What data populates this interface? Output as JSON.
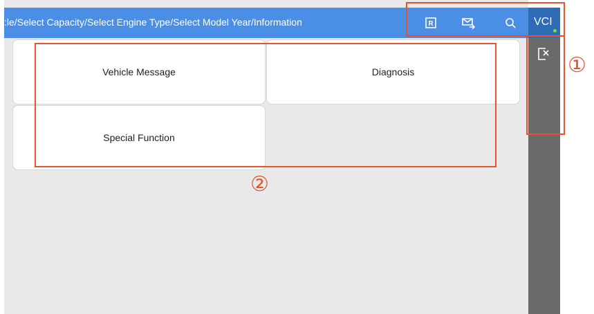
{
  "header": {
    "breadcrumb": ":le/Select Capacity/Select Engine Type/Select Model Year/Information",
    "icons": [
      "r-icon",
      "mail-icon",
      "search-icon"
    ],
    "vci_label": "VCI"
  },
  "tiles": [
    {
      "label": "Vehicle Message"
    },
    {
      "label": "Diagnosis"
    },
    {
      "label": "Special Function"
    }
  ],
  "annotations": {
    "marker_1": "①",
    "marker_2": "②"
  },
  "colors": {
    "header_bg": "#4b8ee6",
    "vci_bg": "#2e6db5",
    "right_panel_bg": "#6a6a6a",
    "content_bg": "#e9e9e9",
    "annotation": "#e8512a",
    "status_dot": "#8cd341"
  }
}
